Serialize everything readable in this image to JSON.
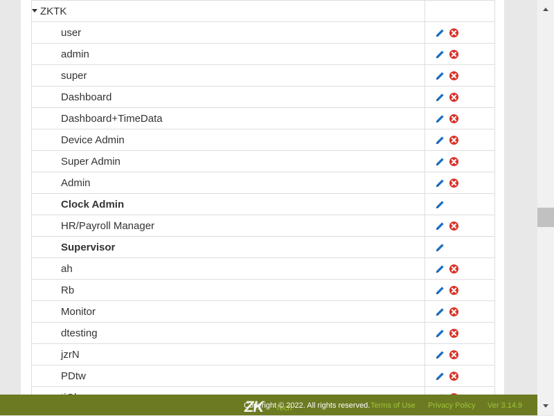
{
  "group": {
    "name": "ZKTK"
  },
  "roles": [
    {
      "name": "user",
      "bold": false,
      "deletable": true
    },
    {
      "name": "admin",
      "bold": false,
      "deletable": true
    },
    {
      "name": "super",
      "bold": false,
      "deletable": true
    },
    {
      "name": "Dashboard",
      "bold": false,
      "deletable": true
    },
    {
      "name": "Dashboard+TimeData",
      "bold": false,
      "deletable": true
    },
    {
      "name": "Device Admin",
      "bold": false,
      "deletable": true
    },
    {
      "name": "Super Admin",
      "bold": false,
      "deletable": true
    },
    {
      "name": "Admin",
      "bold": false,
      "deletable": true
    },
    {
      "name": "Clock Admin",
      "bold": true,
      "deletable": false
    },
    {
      "name": "HR/Payroll Manager",
      "bold": false,
      "deletable": true
    },
    {
      "name": "Supervisor",
      "bold": true,
      "deletable": false
    },
    {
      "name": "ah",
      "bold": false,
      "deletable": true
    },
    {
      "name": "Rb",
      "bold": false,
      "deletable": true
    },
    {
      "name": "Monitor",
      "bold": false,
      "deletable": true
    },
    {
      "name": "dtesting",
      "bold": false,
      "deletable": true
    },
    {
      "name": "jzrN",
      "bold": false,
      "deletable": true
    },
    {
      "name": "PDtw",
      "bold": false,
      "deletable": true
    },
    {
      "name": "tiGh",
      "bold": false,
      "deletable": true
    }
  ],
  "icons": {
    "edit": "pencil-icon",
    "delete": "close-circle-icon"
  },
  "colors": {
    "edit": "#1a6fc4",
    "delete": "#d9342b",
    "footer_bg": "#6c7a22",
    "footer_link": "#9fc43a"
  },
  "footer": {
    "logo": "ZK",
    "logo_sub": "Tech",
    "copyright": "Copyright © 2022. All rights reserved.",
    "terms": "Terms of Use",
    "privacy": "Privacy Policy",
    "version": "Ver 3.14.9"
  }
}
